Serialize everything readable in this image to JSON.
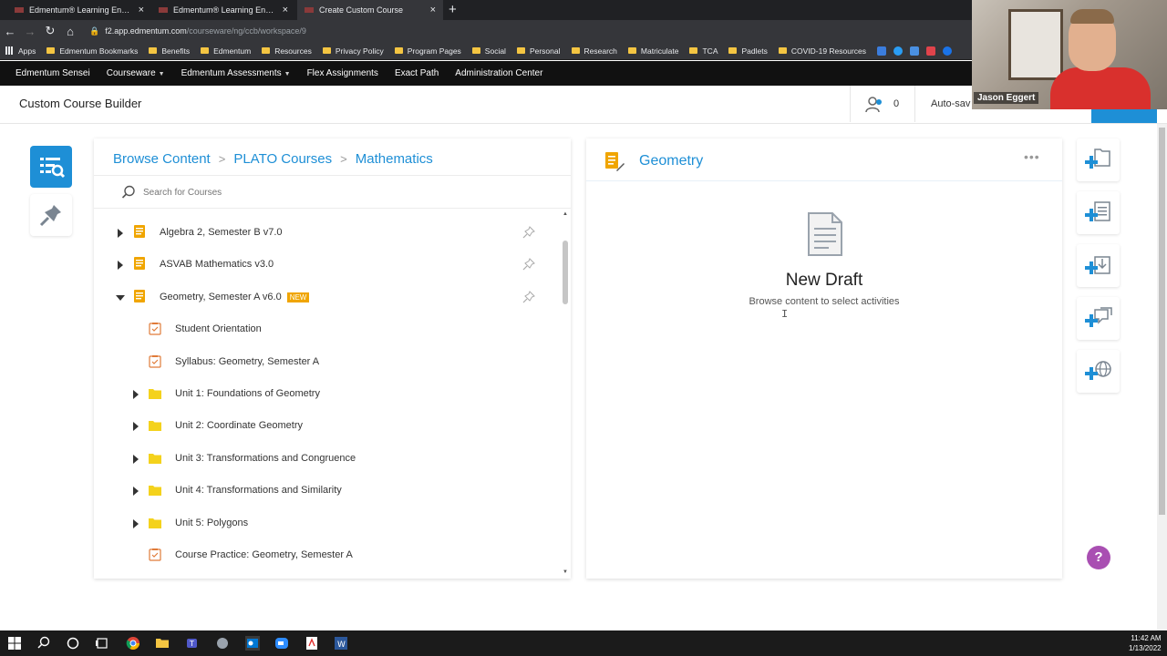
{
  "browser": {
    "tabs": [
      {
        "title": "Edmentum® Learning Environme",
        "active": false
      },
      {
        "title": "Edmentum® Learning Environme",
        "active": false
      },
      {
        "title": "Create Custom Course",
        "active": true
      }
    ],
    "url_host": "f2.app.edmentum.com",
    "url_path": "/courseware/ng/ccb/workspace/9",
    "bookmarks": [
      "Apps",
      "Edmentum Bookmarks",
      "Benefits",
      "Edmentum",
      "Resources",
      "Privacy Policy",
      "Program Pages",
      "Social",
      "Personal",
      "Research",
      "Matriculate",
      "TCA",
      "Padlets",
      "COVID-19 Resources"
    ]
  },
  "app_nav": [
    {
      "label": "Edmentum Sensei",
      "caret": false
    },
    {
      "label": "Courseware",
      "caret": true
    },
    {
      "label": "Edmentum Assessments",
      "caret": true
    },
    {
      "label": "Flex Assignments",
      "caret": false
    },
    {
      "label": "Exact Path",
      "caret": false
    },
    {
      "label": "Administration Center",
      "caret": false
    }
  ],
  "header": {
    "title": "Custom Course Builder",
    "share_count": "0",
    "autosave": "Auto-sav"
  },
  "browse": {
    "crumbs": [
      "Browse Content",
      "PLATO Courses",
      "Mathematics"
    ],
    "search_placeholder": "Search for Courses",
    "items": [
      {
        "label": "Algebra 2, Semester B v7.0",
        "type": "course",
        "arrow": "right",
        "pin": true,
        "badge": ""
      },
      {
        "label": "ASVAB Mathematics v3.0",
        "type": "course",
        "arrow": "right",
        "pin": true,
        "badge": ""
      },
      {
        "label": "Geometry, Semester A v6.0",
        "type": "course",
        "arrow": "down",
        "pin": true,
        "badge": "NEW"
      },
      {
        "label": "Student Orientation",
        "type": "activity",
        "arrow": "none",
        "pin": false,
        "badge": ""
      },
      {
        "label": "Syllabus: Geometry, Semester A",
        "type": "activity",
        "arrow": "none",
        "pin": false,
        "badge": ""
      },
      {
        "label": "Unit 1: Foundations of Geometry",
        "type": "folder",
        "arrow": "right",
        "pin": false,
        "badge": ""
      },
      {
        "label": "Unit 2: Coordinate Geometry",
        "type": "folder",
        "arrow": "right",
        "pin": false,
        "badge": ""
      },
      {
        "label": "Unit 3: Transformations and Congruence",
        "type": "folder",
        "arrow": "right",
        "pin": false,
        "badge": ""
      },
      {
        "label": "Unit 4: Transformations and Similarity",
        "type": "folder",
        "arrow": "right",
        "pin": false,
        "badge": ""
      },
      {
        "label": "Unit 5: Polygons",
        "type": "folder",
        "arrow": "right",
        "pin": false,
        "badge": ""
      },
      {
        "label": "Course Practice: Geometry, Semester A",
        "type": "activity",
        "arrow": "none",
        "pin": false,
        "badge": ""
      }
    ]
  },
  "draft": {
    "title": "Geometry",
    "heading": "New Draft",
    "subtext": "Browse content to select activities"
  },
  "webcam": {
    "name": "Jason Eggert"
  },
  "taskbar": {
    "time": "11:42 AM",
    "date": "1/13/2022"
  },
  "colors": {
    "accent": "#1e8fd6",
    "badge": "#f0a500",
    "folder": "#f4c542",
    "help": "#a94fb2"
  }
}
